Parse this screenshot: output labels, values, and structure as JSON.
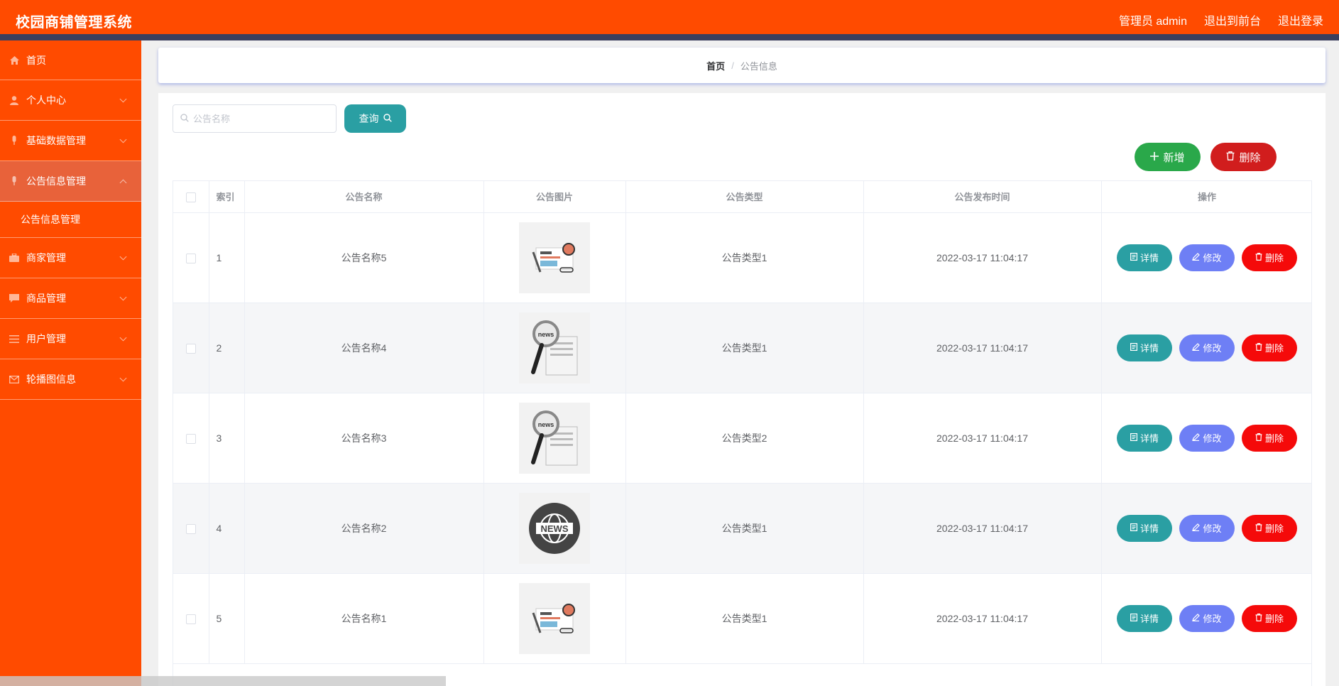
{
  "header": {
    "app_title": "校园商铺管理系统",
    "admin_label": "管理员 admin",
    "back_to_front": "退出到前台",
    "logout": "退出登录"
  },
  "sidebar": {
    "items": [
      {
        "label": "首页",
        "icon": "home-icon"
      },
      {
        "label": "个人中心",
        "icon": "user-icon"
      },
      {
        "label": "基础数据管理",
        "icon": "microphone-icon"
      },
      {
        "label": "公告信息管理",
        "icon": "microphone-icon"
      },
      {
        "label": "商家管理",
        "icon": "briefcase-icon"
      },
      {
        "label": "商品管理",
        "icon": "chat-icon"
      },
      {
        "label": "用户管理",
        "icon": "list-icon"
      },
      {
        "label": "轮播图信息",
        "icon": "mail-icon"
      }
    ],
    "submenu": {
      "label": "公告信息管理"
    }
  },
  "breadcrumb": {
    "home": "首页",
    "separator": "/",
    "current": "公告信息"
  },
  "search": {
    "placeholder": "公告名称",
    "button_label": "查询"
  },
  "actions": {
    "add_label": "新增",
    "delete_label": "删除"
  },
  "table": {
    "columns": [
      "索引",
      "公告名称",
      "公告图片",
      "公告类型",
      "公告发布时间",
      "操作"
    ],
    "rows": [
      {
        "index": "1",
        "name": "公告名称5",
        "image": "news-desk",
        "type": "公告类型1",
        "time": "2022-03-17 11:04:17"
      },
      {
        "index": "2",
        "name": "公告名称4",
        "image": "news-magnifier",
        "type": "公告类型1",
        "time": "2022-03-17 11:04:17"
      },
      {
        "index": "3",
        "name": "公告名称3",
        "image": "news-magnifier",
        "type": "公告类型2",
        "time": "2022-03-17 11:04:17"
      },
      {
        "index": "4",
        "name": "公告名称2",
        "image": "news-globe",
        "type": "公告类型1",
        "time": "2022-03-17 11:04:17"
      },
      {
        "index": "5",
        "name": "公告名称1",
        "image": "news-desk",
        "type": "公告类型1",
        "time": "2022-03-17 11:04:17"
      }
    ],
    "row_actions": {
      "detail": "详情",
      "edit": "修改",
      "delete": "删除"
    }
  },
  "colors": {
    "brand": "#ff4b00",
    "header_border": "#3b3f5e",
    "query": "#2a9fa3",
    "add": "#2aa84a",
    "batch_delete": "#d11d1d",
    "edit": "#6e7ff5",
    "row_delete": "#f50a0a"
  }
}
